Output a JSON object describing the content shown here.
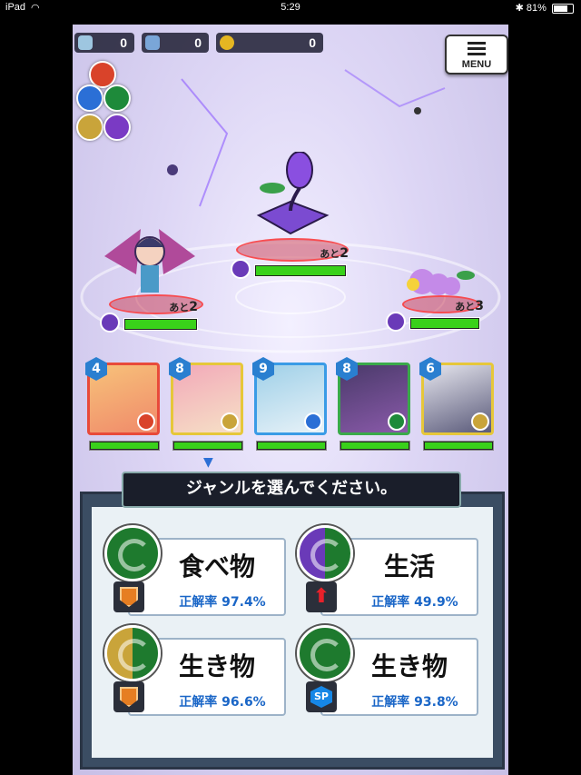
{
  "status": {
    "device": "iPad",
    "time": "5:29",
    "battery": "81%",
    "battery_level": 0.81
  },
  "resources": [
    {
      "name": "orb-icon",
      "value": "0",
      "color": "#9ec6e0"
    },
    {
      "name": "ticket-icon",
      "value": "0",
      "color": "#7aa6d8"
    },
    {
      "name": "coin-icon",
      "value": "0",
      "color": "#e5b622"
    }
  ],
  "menu": {
    "label": "MENU"
  },
  "element_wheel": [
    {
      "name": "fire-orb-icon",
      "color": "#d9432a"
    },
    {
      "name": "water-orb-icon",
      "color": "#2b6fd6"
    },
    {
      "name": "wood-orb-icon",
      "color": "#1e8a3a"
    },
    {
      "name": "light-orb-icon",
      "color": "#c9a43a"
    },
    {
      "name": "dark-orb-icon",
      "color": "#7a3ac4"
    }
  ],
  "enemies": [
    {
      "name": "book-monster",
      "turn_prefix": "あと",
      "turn": "2",
      "hp": 1.0
    },
    {
      "name": "harpy-girl",
      "turn_prefix": "あと",
      "turn": "2",
      "hp": 1.0
    },
    {
      "name": "caterpillar",
      "turn_prefix": "あと",
      "turn": "3",
      "hp": 1.0
    }
  ],
  "party": [
    {
      "level": "4",
      "border": "#e84a3a",
      "bg": "#f7c27a",
      "attr_color": "#d9432a",
      "attr": "fire",
      "hp": 1.0
    },
    {
      "level": "8",
      "border": "#e6c73a",
      "bg": "#f2a9b9",
      "attr_color": "#c9a43a",
      "attr": "light",
      "hp": 1.0
    },
    {
      "level": "9",
      "border": "#3a9be6",
      "bg": "#9fd0e8",
      "attr_color": "#2b6fd6",
      "attr": "water",
      "hp": 1.0
    },
    {
      "level": "8",
      "border": "#3aaa4a",
      "bg": "#4a3a6a",
      "attr_color": "#1e8a3a",
      "attr": "wood",
      "hp": 1.0
    },
    {
      "level": "6",
      "border": "#e6c73a",
      "bg": "#e6e6ee",
      "attr_color": "#c9a43a",
      "attr": "light",
      "hp": 1.0
    }
  ],
  "prompt": "ジャンルを選んでください。",
  "choices": [
    {
      "title": "食べ物",
      "rate": "正解率 97.4%",
      "emblem": "#1e7a2e",
      "badge": "shield"
    },
    {
      "title": "生活",
      "rate": "正解率 49.9%",
      "emblem": "#6a3ab8",
      "badge": "up-arrow"
    },
    {
      "title": "生き物",
      "rate": "正解率 96.6%",
      "emblem": "#c9a43a",
      "badge": "shield"
    },
    {
      "title": "生き物",
      "rate": "正解率 93.8%",
      "emblem": "#1e7a2e",
      "badge": "sp",
      "badge_label": "SP"
    }
  ]
}
